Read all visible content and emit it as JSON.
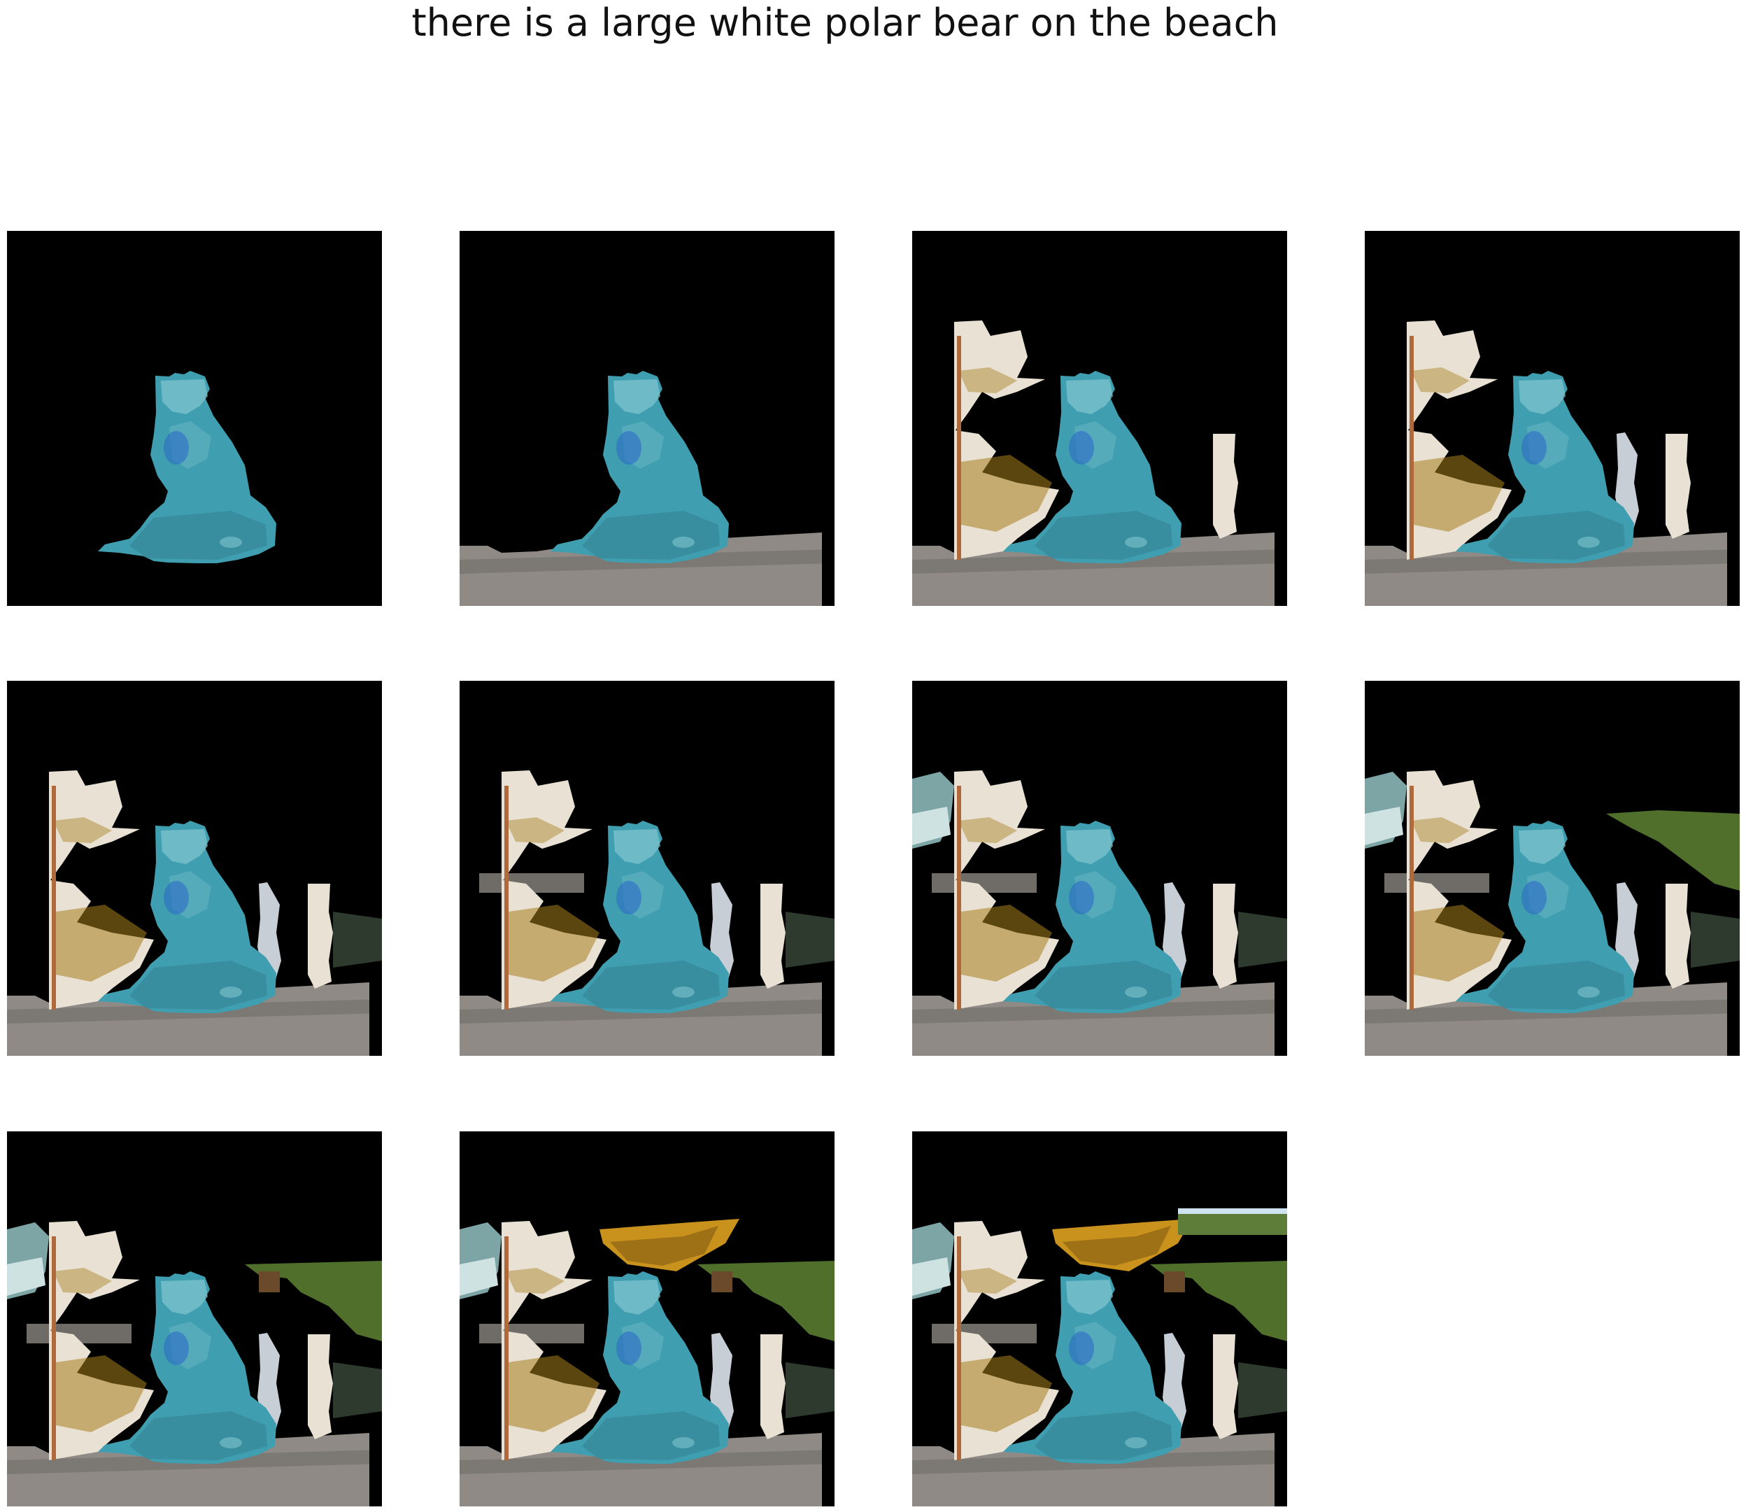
{
  "title": "there is a large white polar bear on the beach",
  "figure": {
    "grid": {
      "rows": 3,
      "columns": 4
    },
    "panel_count": 11,
    "background_color": "#000000",
    "panels": [
      {
        "step": 1,
        "layers": [
          "bear"
        ]
      },
      {
        "step": 2,
        "layers": [
          "ledge",
          "bear"
        ]
      },
      {
        "step": 3,
        "layers": [
          "ledge",
          "water",
          "sliver",
          "bear"
        ]
      },
      {
        "step": 4,
        "layers": [
          "ledge",
          "water",
          "sliver",
          "waterfall",
          "bear"
        ]
      },
      {
        "step": 5,
        "layers": [
          "ledge",
          "water",
          "sliver",
          "waterfall",
          "pool",
          "bear"
        ]
      },
      {
        "step": 6,
        "layers": [
          "ledge",
          "rail",
          "water",
          "sliver",
          "waterfall",
          "pool",
          "bear"
        ]
      },
      {
        "step": 7,
        "layers": [
          "ledge",
          "rail",
          "water",
          "sliver",
          "waterfall",
          "pool",
          "wave",
          "bear"
        ]
      },
      {
        "step": 8,
        "layers": [
          "ledge",
          "rail",
          "water",
          "sliver",
          "waterfall",
          "pool",
          "wave",
          "foliage_strip",
          "bear"
        ]
      },
      {
        "step": 9,
        "layers": [
          "ledge",
          "rail",
          "water",
          "sliver",
          "waterfall",
          "pool",
          "wave",
          "foliage_block",
          "bear"
        ]
      },
      {
        "step": 10,
        "layers": [
          "ledge",
          "rail",
          "water",
          "sliver",
          "waterfall",
          "pool",
          "wave",
          "foliage_block",
          "gold_leaf",
          "bear"
        ]
      },
      {
        "step": 11,
        "layers": [
          "ledge",
          "rail",
          "water",
          "sliver",
          "waterfall",
          "pool",
          "wave",
          "foliage_block",
          "gold_leaf",
          "tree_strip",
          "bear"
        ]
      }
    ]
  },
  "colors": {
    "bear": "#3f9fb0",
    "bear_highlight": "#7fc3cf",
    "bear_shadow": "#2a6f80",
    "ledge": "#8f8a86",
    "ledge_dark": "#5a5552",
    "water": "#e8e1d4",
    "water_gold": "#a8801e",
    "waterfall": "#c7ced6",
    "pool": "#2e3a2e",
    "foliage": "#4f6f2a",
    "gold_leaf": "#c8921c",
    "rail": "#6f6c68"
  }
}
